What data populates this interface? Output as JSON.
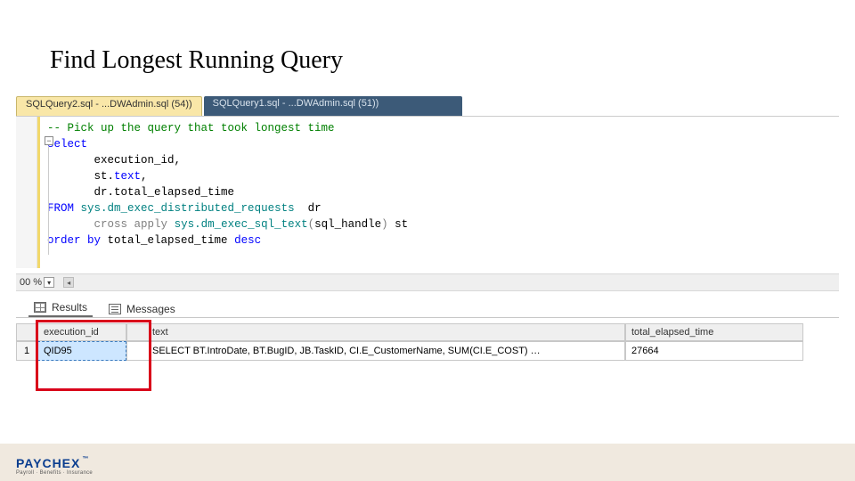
{
  "title": "Find Longest Running Query",
  "tabs": {
    "active_label": "SQLQuery2.sql - ...DWAdmin.sql (54))",
    "inactive_label": "SQLQuery1.sql - ...DWAdmin.sql (51))"
  },
  "sql": {
    "comment": "-- Pick up the query that took longest time",
    "kw_select": "select",
    "col1": "execution_id,",
    "col2_alias": "st.",
    "col2_field": "text",
    "col2_comma": ",",
    "col3": "dr.total_elapsed_time",
    "kw_from": "FROM",
    "sys_obj": "sys.dm_exec_distributed_requests",
    "alias_dr": "  dr",
    "kw_cross": "cross",
    "kw_apply": "apply",
    "sys_fn": "sys.dm_exec_sql_text",
    "fn_open": "(",
    "fn_arg": "sql_handle",
    "fn_close": ")",
    "alias_st": " st",
    "kw_order": "order by",
    "order_col": "total_elapsed_time",
    "kw_desc": "desc"
  },
  "zoom": "00 %",
  "result_tabs": {
    "results": "Results",
    "messages": "Messages"
  },
  "grid": {
    "headers": {
      "execution_id": "execution_id",
      "text": "text",
      "total_elapsed_time": "total_elapsed_time"
    },
    "row1": {
      "num": "1",
      "execution_id": "QID95",
      "text": "SELECT BT.IntroDate,   BT.BugID,   JB.TaskID,   CI.E_CustomerName,   SUM(CI.E_COST) …",
      "total_elapsed_time": "27664"
    }
  },
  "logo": {
    "brand": "PAYCHEX",
    "tagline": "Payroll · Benefits · Insurance"
  }
}
